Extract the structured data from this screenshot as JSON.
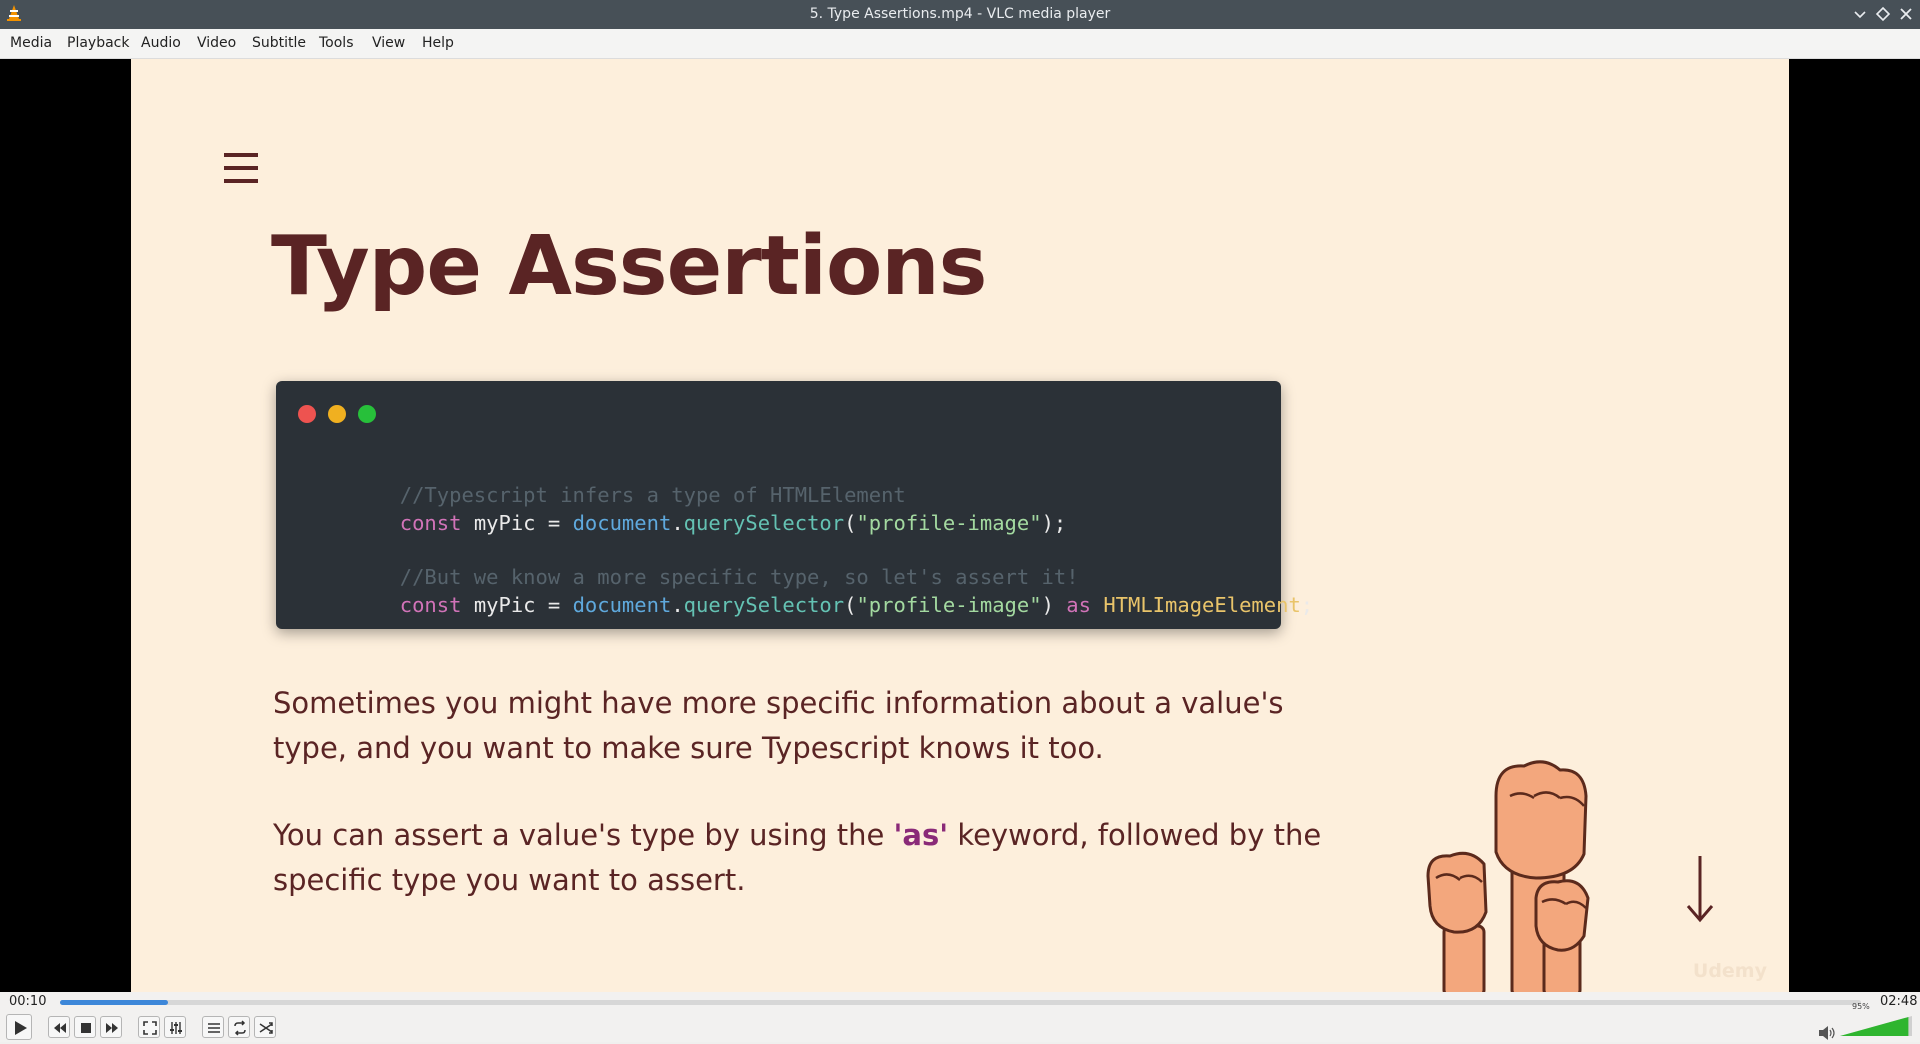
{
  "window": {
    "title": "5. Type Assertions.mp4 - VLC media player"
  },
  "menu": [
    "Media",
    "Playback",
    "Audio",
    "Video",
    "Subtitle",
    "Tools",
    "View",
    "Help"
  ],
  "slide": {
    "title": "Type Assertions",
    "code": {
      "comment1": "//Typescript infers a type of HTMLElement",
      "line1": {
        "kw": "const",
        "var": "myPic",
        "op": " = ",
        "obj": "document",
        "dot": ".",
        "fn": "querySelector",
        "open": "(",
        "str": "\"profile-image\"",
        "close": ");"
      },
      "comment2": "//But we know a more specific type, so let's assert it!",
      "line2": {
        "kw": "const",
        "var": "myPic",
        "op": " = ",
        "obj": "document",
        "dot": ".",
        "fn": "querySelector",
        "open": "(",
        "str": "\"profile-image\"",
        "close": ") ",
        "as": "as",
        "type": "HTMLImageElement",
        "end": ";"
      }
    },
    "para1": "Sometimes you might have more specific information about a value's type, and you want to make sure Typescript knows it too.",
    "para2": {
      "before": "You can assert a value's type by using the ",
      "keyword": "'as'",
      "after": " keyword, followed by the specific type you want to assert."
    },
    "watermark": "Udemy"
  },
  "player": {
    "elapsed": "00:10",
    "total": "02:48",
    "progress_percent": 6,
    "volume_label": "95%",
    "volume_percent": 95
  },
  "colors": {
    "accent": "#3d87d9",
    "slide_bg": "#fdefdc",
    "title": "#5a2424",
    "volume": "#2fb52f"
  }
}
